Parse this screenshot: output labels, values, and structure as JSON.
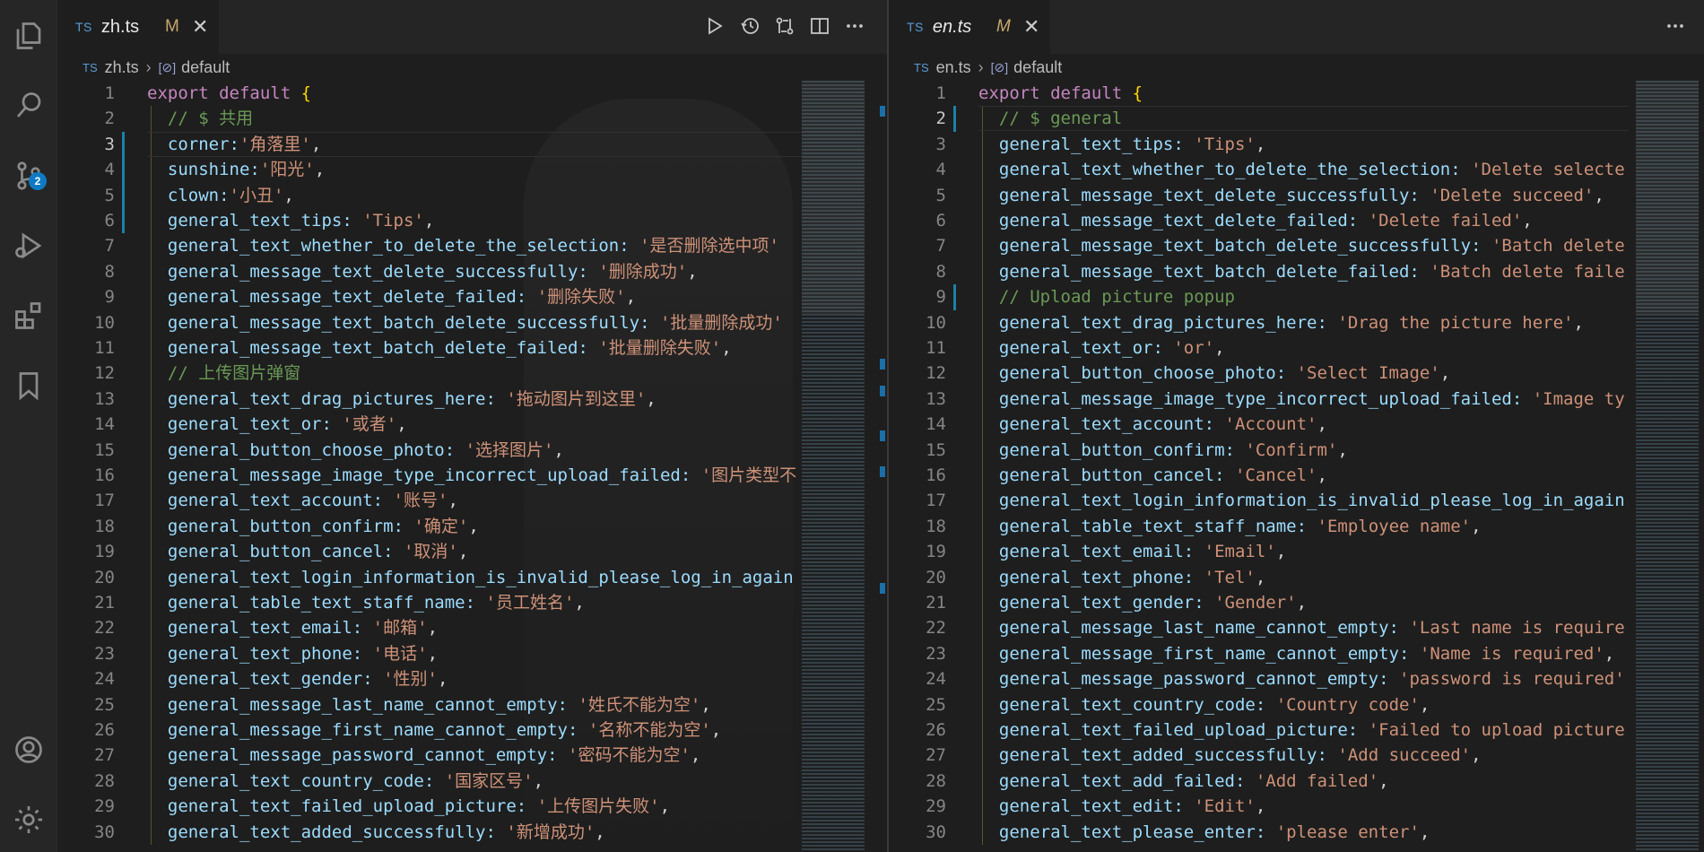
{
  "activity_bar": {
    "scm_badge": "2"
  },
  "left": {
    "tab": {
      "type": "TS",
      "filename": "zh.ts",
      "status": "M"
    },
    "breadcrumb": {
      "type": "TS",
      "file": "zh.ts",
      "symbol": "default"
    },
    "lines": [
      {
        "n": "1",
        "k": "",
        "kw": "export default ",
        "v": "",
        "br": "{"
      },
      {
        "n": "2",
        "com": "  // $ 共用"
      },
      {
        "n": "3",
        "k": "  corner:",
        "v": "'角落里'",
        "p": ","
      },
      {
        "n": "4",
        "k": "  sunshine:",
        "v": "'阳光'",
        "p": ","
      },
      {
        "n": "5",
        "k": "  clown:",
        "v": "'小丑'",
        "p": ","
      },
      {
        "n": "6",
        "k": "  general_text_tips: ",
        "v": "'Tips'",
        "p": ","
      },
      {
        "n": "7",
        "k": "  general_text_whether_to_delete_the_selection: ",
        "v": "'是否删除选中项'",
        "p": ""
      },
      {
        "n": "8",
        "k": "  general_message_text_delete_successfully: ",
        "v": "'删除成功'",
        "p": ","
      },
      {
        "n": "9",
        "k": "  general_message_text_delete_failed: ",
        "v": "'删除失败'",
        "p": ","
      },
      {
        "n": "10",
        "k": "  general_message_text_batch_delete_successfully: ",
        "v": "'批量删除成功'",
        "p": ""
      },
      {
        "n": "11",
        "k": "  general_message_text_batch_delete_failed: ",
        "v": "'批量删除失败'",
        "p": ","
      },
      {
        "n": "12",
        "com": "  // 上传图片弹窗"
      },
      {
        "n": "13",
        "k": "  general_text_drag_pictures_here: ",
        "v": "'拖动图片到这里'",
        "p": ","
      },
      {
        "n": "14",
        "k": "  general_text_or: ",
        "v": "'或者'",
        "p": ","
      },
      {
        "n": "15",
        "k": "  general_button_choose_photo: ",
        "v": "'选择图片'",
        "p": ","
      },
      {
        "n": "16",
        "k": "  general_message_image_type_incorrect_upload_failed: ",
        "v": "'图片类型不",
        "p": ""
      },
      {
        "n": "17",
        "k": "  general_text_account: ",
        "v": "'账号'",
        "p": ","
      },
      {
        "n": "18",
        "k": "  general_button_confirm: ",
        "v": "'确定'",
        "p": ","
      },
      {
        "n": "19",
        "k": "  general_button_cancel: ",
        "v": "'取消'",
        "p": ","
      },
      {
        "n": "20",
        "k": "  general_text_login_information_is_invalid_please_log_in_again",
        "v": "",
        "p": ""
      },
      {
        "n": "21",
        "k": "  general_table_text_staff_name: ",
        "v": "'员工姓名'",
        "p": ","
      },
      {
        "n": "22",
        "k": "  general_text_email: ",
        "v": "'邮箱'",
        "p": ","
      },
      {
        "n": "23",
        "k": "  general_text_phone: ",
        "v": "'电话'",
        "p": ","
      },
      {
        "n": "24",
        "k": "  general_text_gender: ",
        "v": "'性别'",
        "p": ","
      },
      {
        "n": "25",
        "k": "  general_message_last_name_cannot_empty: ",
        "v": "'姓氏不能为空'",
        "p": ","
      },
      {
        "n": "26",
        "k": "  general_message_first_name_cannot_empty: ",
        "v": "'名称不能为空'",
        "p": ","
      },
      {
        "n": "27",
        "k": "  general_message_password_cannot_empty: ",
        "v": "'密码不能为空'",
        "p": ","
      },
      {
        "n": "28",
        "k": "  general_text_country_code: ",
        "v": "'国家区号'",
        "p": ","
      },
      {
        "n": "29",
        "k": "  general_text_failed_upload_picture: ",
        "v": "'上传图片失败'",
        "p": ","
      },
      {
        "n": "30",
        "k": "  general_text_added_successfully: ",
        "v": "'新增成功'",
        "p": ","
      }
    ]
  },
  "right": {
    "tab": {
      "type": "TS",
      "filename": "en.ts",
      "status": "M"
    },
    "breadcrumb": {
      "type": "TS",
      "file": "en.ts",
      "symbol": "default"
    },
    "lines": [
      {
        "n": "1",
        "k": "",
        "kw": "export default ",
        "v": "",
        "br": "{"
      },
      {
        "n": "2",
        "com": "  // $ general"
      },
      {
        "n": "3",
        "k": "  general_text_tips: ",
        "v": "'Tips'",
        "p": ","
      },
      {
        "n": "4",
        "k": "  general_text_whether_to_delete_the_selection: ",
        "v": "'Delete selecte",
        "p": ""
      },
      {
        "n": "5",
        "k": "  general_message_text_delete_successfully: ",
        "v": "'Delete succeed'",
        "p": ","
      },
      {
        "n": "6",
        "k": "  general_message_text_delete_failed: ",
        "v": "'Delete failed'",
        "p": ","
      },
      {
        "n": "7",
        "k": "  general_message_text_batch_delete_successfully: ",
        "v": "'Batch delete",
        "p": ""
      },
      {
        "n": "8",
        "k": "  general_message_text_batch_delete_failed: ",
        "v": "'Batch delete faile",
        "p": ""
      },
      {
        "n": "9",
        "com": "  // Upload picture popup"
      },
      {
        "n": "10",
        "k": "  general_text_drag_pictures_here: ",
        "v": "'Drag the picture here'",
        "p": ","
      },
      {
        "n": "11",
        "k": "  general_text_or: ",
        "v": "'or'",
        "p": ","
      },
      {
        "n": "12",
        "k": "  general_button_choose_photo: ",
        "v": "'Select Image'",
        "p": ","
      },
      {
        "n": "13",
        "k": "  general_message_image_type_incorrect_upload_failed: ",
        "v": "'Image ty",
        "p": ""
      },
      {
        "n": "14",
        "k": "  general_text_account: ",
        "v": "'Account'",
        "p": ","
      },
      {
        "n": "15",
        "k": "  general_button_confirm: ",
        "v": "'Confirm'",
        "p": ","
      },
      {
        "n": "16",
        "k": "  general_button_cancel: ",
        "v": "'Cancel'",
        "p": ","
      },
      {
        "n": "17",
        "k": "  general_text_login_information_is_invalid_please_log_in_again",
        "v": "",
        "p": ""
      },
      {
        "n": "18",
        "k": "  general_table_text_staff_name: ",
        "v": "'Employee name'",
        "p": ","
      },
      {
        "n": "19",
        "k": "  general_text_email: ",
        "v": "'Email'",
        "p": ","
      },
      {
        "n": "20",
        "k": "  general_text_phone: ",
        "v": "'Tel'",
        "p": ","
      },
      {
        "n": "21",
        "k": "  general_text_gender: ",
        "v": "'Gender'",
        "p": ","
      },
      {
        "n": "22",
        "k": "  general_message_last_name_cannot_empty: ",
        "v": "'Last name is require",
        "p": ""
      },
      {
        "n": "23",
        "k": "  general_message_first_name_cannot_empty: ",
        "v": "'Name is required'",
        "p": ","
      },
      {
        "n": "24",
        "k": "  general_message_password_cannot_empty: ",
        "v": "'password is required'",
        "p": ""
      },
      {
        "n": "25",
        "k": "  general_text_country_code: ",
        "v": "'Country code'",
        "p": ","
      },
      {
        "n": "26",
        "k": "  general_text_failed_upload_picture: ",
        "v": "'Failed to upload picture",
        "p": ""
      },
      {
        "n": "27",
        "k": "  general_text_added_successfully: ",
        "v": "'Add succeed'",
        "p": ","
      },
      {
        "n": "28",
        "k": "  general_text_add_failed: ",
        "v": "'Add failed'",
        "p": ","
      },
      {
        "n": "29",
        "k": "  general_text_edit: ",
        "v": "'Edit'",
        "p": ","
      },
      {
        "n": "30",
        "k": "  general_text_please_enter: ",
        "v": "'please enter'",
        "p": ","
      }
    ]
  },
  "colors": {
    "key": "#9cdcfe",
    "string": "#ce9178",
    "comment": "#6a9955",
    "keyword": "#c586c0",
    "bracket": "#ffd700",
    "badge": "#0e7ac4"
  }
}
